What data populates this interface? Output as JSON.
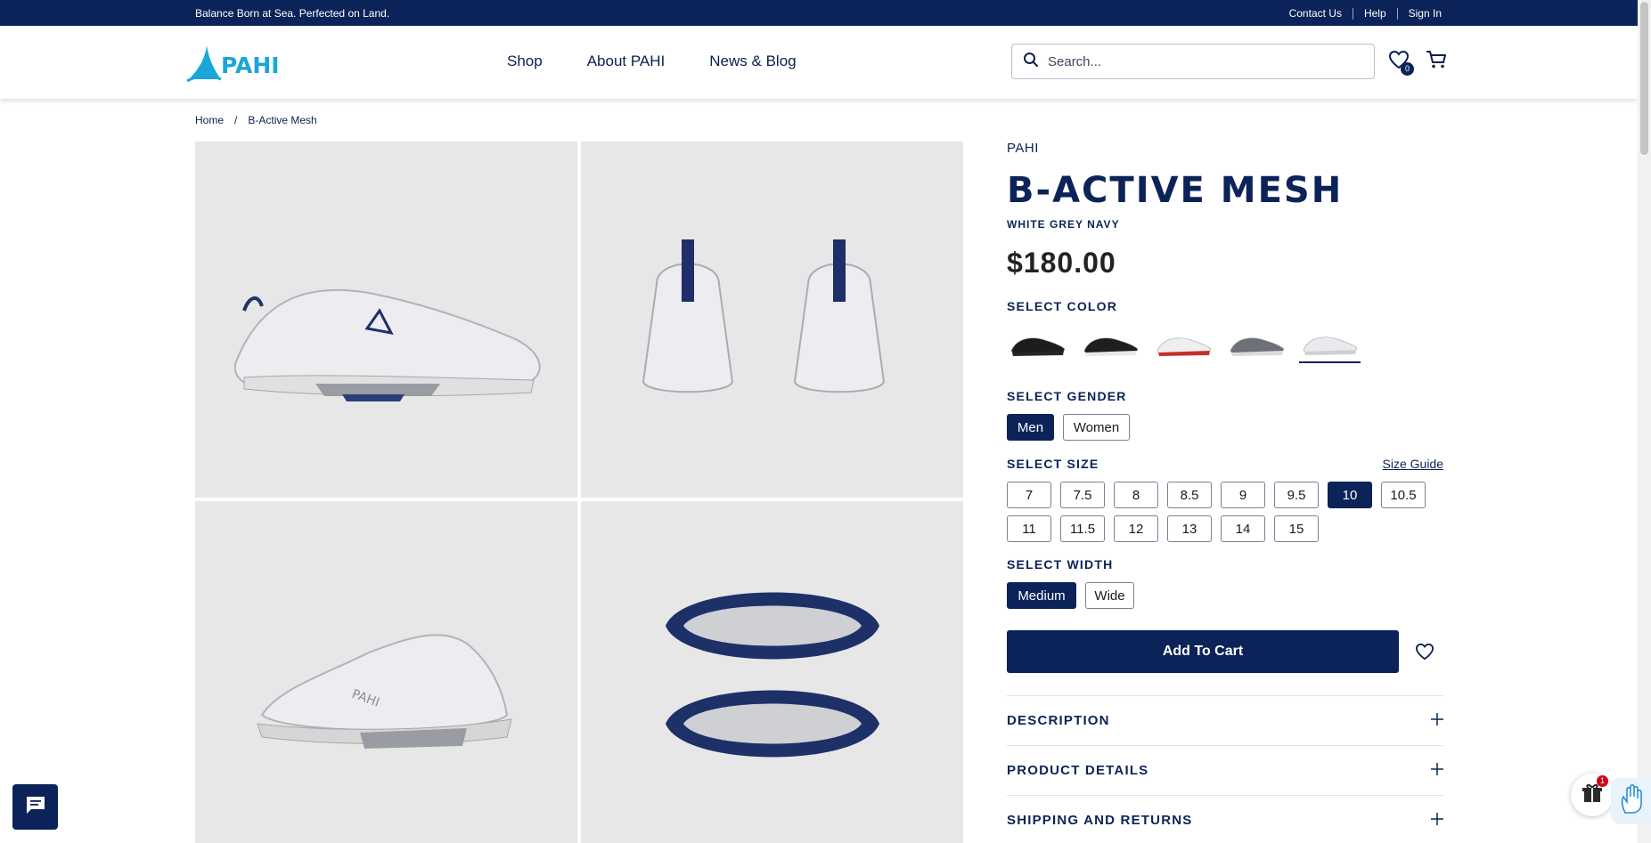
{
  "topbar": {
    "tagline": "Balance Born at Sea. Perfected on Land.",
    "links": [
      "Contact Us",
      "Help",
      "Sign In"
    ]
  },
  "header": {
    "logo_text": "PAHI",
    "nav": [
      "Shop",
      "About PAHI",
      "News & Blog"
    ],
    "search_placeholder": "Search...",
    "wishlist_count": "0"
  },
  "breadcrumb": [
    "Home",
    "/",
    "B-Active Mesh"
  ],
  "product": {
    "brand": "PAHI",
    "title": "B-ACTIVE MESH",
    "colorway": "WHITE GREY NAVY",
    "price": "$180.00",
    "color_label": "SELECT COLOR",
    "colors": [
      {
        "name": "black",
        "upper": "#1c1c1c",
        "sole": "#262626"
      },
      {
        "name": "black-white",
        "upper": "#1e1e1e",
        "sole": "#e8e8e8"
      },
      {
        "name": "white-red",
        "upper": "#efefef",
        "sole": "#c4302b"
      },
      {
        "name": "grey",
        "upper": "#6e7077",
        "sole": "#dadada"
      },
      {
        "name": "white-grey-navy",
        "upper": "#e9e9ee",
        "sole": "#cfd0d4"
      }
    ],
    "selected_color_index": 4,
    "gender_label": "SELECT GENDER",
    "genders": [
      "Men",
      "Women"
    ],
    "selected_gender": "Men",
    "size_label": "SELECT SIZE",
    "size_guide": "Size Guide",
    "sizes": [
      "7",
      "7.5",
      "8",
      "8.5",
      "9",
      "9.5",
      "10",
      "10.5",
      "11",
      "11.5",
      "12",
      "13",
      "14",
      "15"
    ],
    "selected_size": "10",
    "width_label": "SELECT WIDTH",
    "widths": [
      "Medium",
      "Wide"
    ],
    "selected_width": "Medium",
    "add_to_cart": "Add To Cart",
    "accordion": [
      "DESCRIPTION",
      "PRODUCT DETAILS",
      "SHIPPING AND RETURNS"
    ]
  },
  "widgets": {
    "gift_count": "1"
  },
  "colors": {
    "navy": "#0b2358",
    "logo_cyan": "#1aa6d8"
  }
}
